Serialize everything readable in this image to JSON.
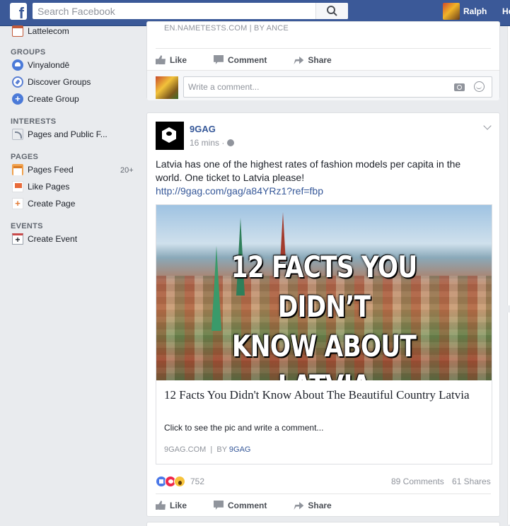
{
  "topbar": {
    "logo": "f",
    "search_placeholder": "Search Facebook",
    "user_name": "Ralph",
    "home_label": "Ho"
  },
  "sidebar": {
    "top_item": "Lattelecom",
    "groups_head": "GROUPS",
    "groups": [
      "Vinyalondē",
      "Discover Groups",
      "Create Group"
    ],
    "interests_head": "INTERESTS",
    "interests": [
      "Pages and Public F..."
    ],
    "pages_head": "PAGES",
    "pages": [
      "Pages Feed",
      "Like Pages",
      "Create Page"
    ],
    "pages_feed_count": "20+",
    "events_head": "EVENTS",
    "events": [
      "Create Event"
    ]
  },
  "prev_post": {
    "domain": "EN.NAMETESTS.COM  |  BY ANCE",
    "like": "Like",
    "comment": "Comment",
    "share": "Share",
    "comment_placeholder": "Write a comment..."
  },
  "post": {
    "page_name": "9GAG",
    "time": "16 mins ·",
    "text": "Latvia has one of the highest rates of fashion models per capita in the world. One ticket to Latvia please!",
    "link": "http://9gag.com/gag/a84YRz1?ref=fbp",
    "image_headline_1": "12 FACTS YOU DIDN’T",
    "image_headline_2": "KNOW ABOUT LATVIA",
    "preview_title": "12 Facts You Didn't Know About The Beautiful Country Latvia",
    "preview_desc": "Click to see the pic and write a comment...",
    "preview_domain": "9GAG.COM",
    "preview_by_prefix": "  |  BY ",
    "preview_by": "9GAG",
    "reaction_count": "752",
    "comments_count": "89 Comments",
    "shares_count": "61 Shares",
    "like": "Like",
    "comment": "Comment",
    "share": "Share"
  }
}
